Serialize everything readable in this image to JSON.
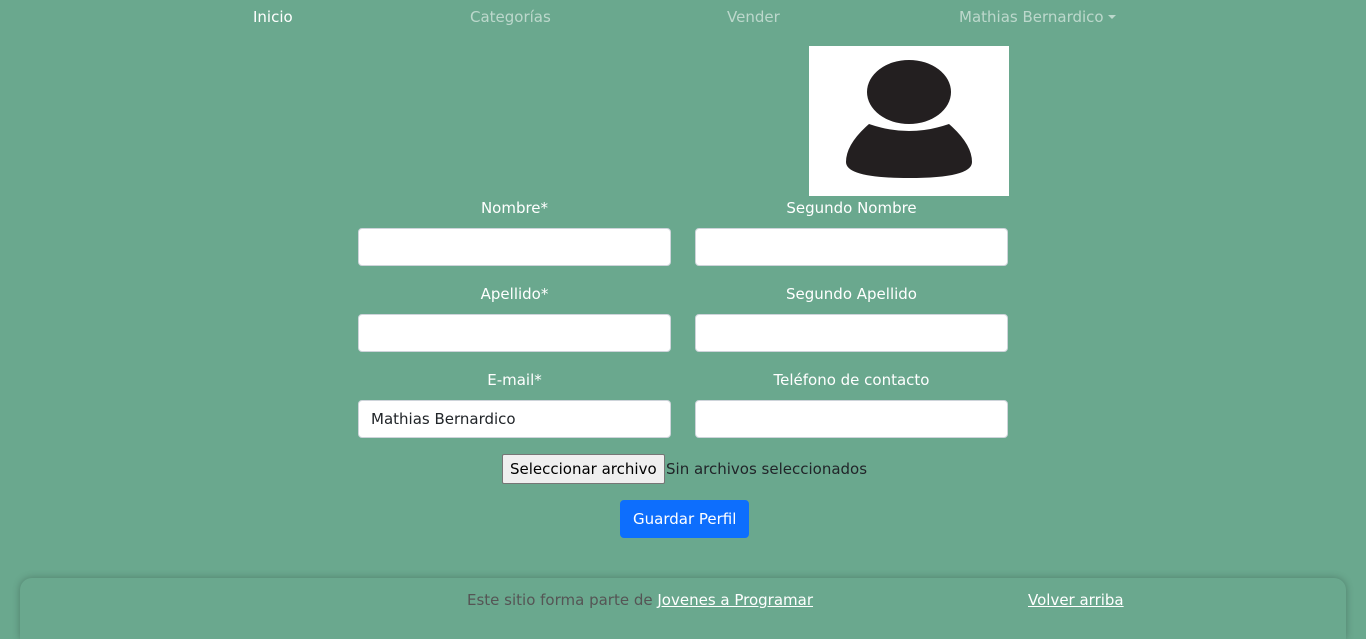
{
  "nav": {
    "items": [
      {
        "label": "Inicio"
      },
      {
        "label": "Categorías"
      },
      {
        "label": "Vender"
      }
    ],
    "user_menu_label": "Mathias Bernardico"
  },
  "profile": {
    "avatar_icon": "user-silhouette-icon"
  },
  "form": {
    "fields": [
      {
        "label": "Nombre*",
        "value": ""
      },
      {
        "label": "Segundo Nombre",
        "value": ""
      },
      {
        "label": "Apellido*",
        "value": ""
      },
      {
        "label": "Segundo Apellido",
        "value": ""
      },
      {
        "label": "E-mail*",
        "value": "Mathias Bernardico"
      },
      {
        "label": "Teléfono de contacto",
        "value": ""
      }
    ],
    "file_button_label": "Seleccionar archivo",
    "file_status": "Sin archivos seleccionados",
    "save_label": "Guardar Perfil"
  },
  "footer": {
    "text": "Este sitio forma parte de",
    "link_label": "Jovenes a Programar",
    "back_to_top_label": "Volver arriba"
  },
  "colors": {
    "background": "#6aa88e",
    "primary_button": "#0d6efd"
  }
}
